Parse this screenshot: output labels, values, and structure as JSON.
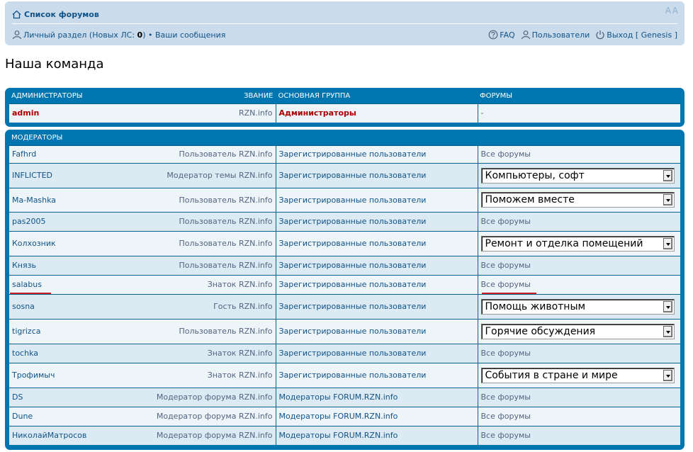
{
  "nav": {
    "forum_index": "Список форумов",
    "font_size": "A A",
    "user_panel": "Личный раздел",
    "new_pm_prefix": " (Новых ЛС: ",
    "new_pm_count": "0",
    "new_pm_suffix": ")",
    "bullet": " • ",
    "your_posts": "Ваши сообщения",
    "faq": "FAQ",
    "members": "Пользователи",
    "logout": "Выход [ Genesis ]"
  },
  "page_title": "Наша команда",
  "admins": {
    "headers": [
      "Администраторы",
      "Звание",
      "Основная группа",
      "Форумы"
    ],
    "rows": [
      {
        "name": "admin",
        "rank": "RZN.info",
        "group": "Администраторы",
        "forums": "-"
      }
    ]
  },
  "moderators": {
    "headers": [
      "Модераторы"
    ],
    "rows": [
      {
        "name": "Fafhrd",
        "rank": "Пользователь RZN.info",
        "group": "Зарегистрированные пользователи",
        "forums": "Все форумы",
        "select": null
      },
      {
        "name": "INFLICTED",
        "rank": "Модератор темы RZN.info",
        "group": "Зарегистрированные пользователи",
        "forums": null,
        "select": "Компьютеры, софт"
      },
      {
        "name": "Ma-Mashka",
        "rank": "Пользователь RZN.info",
        "group": "Зарегистрированные пользователи",
        "forums": null,
        "select": "Поможем вместе"
      },
      {
        "name": "pas2005",
        "rank": "Пользователь RZN.info",
        "group": "Зарегистрированные пользователи",
        "forums": "Все форумы",
        "select": null
      },
      {
        "name": "Колхозник",
        "rank": "Пользователь RZN.info",
        "group": "Зарегистрированные пользователи",
        "forums": null,
        "select": "Ремонт и отделка помещений"
      },
      {
        "name": "Князь",
        "rank": "Пользователь RZN.info",
        "group": "Зарегистрированные пользователи",
        "forums": "Все форумы",
        "select": null
      },
      {
        "name": "salabus",
        "rank": "Знаток RZN.info",
        "group": "Зарегистрированные пользователи",
        "forums": "Все форумы",
        "select": null
      },
      {
        "name": "sosna",
        "rank": "Гость RZN.info",
        "group": "Зарегистрированные пользователи",
        "forums": null,
        "select": "Помощь животным"
      },
      {
        "name": "tigrizca",
        "rank": "Пользователь RZN.info",
        "group": "Зарегистрированные пользователи",
        "forums": null,
        "select": "Горячие обсуждения"
      },
      {
        "name": "tochka",
        "rank": "Знаток RZN.info",
        "group": "Зарегистрированные пользователи",
        "forums": "Все форумы",
        "select": null
      },
      {
        "name": "Трофимыч",
        "rank": "Знаток RZN.info",
        "group": "Зарегистрированные пользователи",
        "forums": null,
        "select": "События в стране и мире"
      },
      {
        "name": "DS",
        "rank": "Модератор форума RZN.info",
        "group": "Модераторы FORUM.RZN.info",
        "forums": "Все форумы",
        "select": null
      },
      {
        "name": "Dune",
        "rank": "Модератор форума RZN.info",
        "group": "Модераторы FORUM.RZN.info",
        "forums": "Все форумы",
        "select": null
      },
      {
        "name": "НиколайМатросов",
        "rank": "Модератор форума RZN.info",
        "group": "Модераторы FORUM.RZN.info",
        "forums": "Все форумы",
        "select": null
      }
    ]
  },
  "colors": {
    "panel": "#0076b1",
    "navbar": "#cadceb",
    "link": "#105289",
    "admin": "#aa0000",
    "highlight_underline": "#cc2222"
  }
}
